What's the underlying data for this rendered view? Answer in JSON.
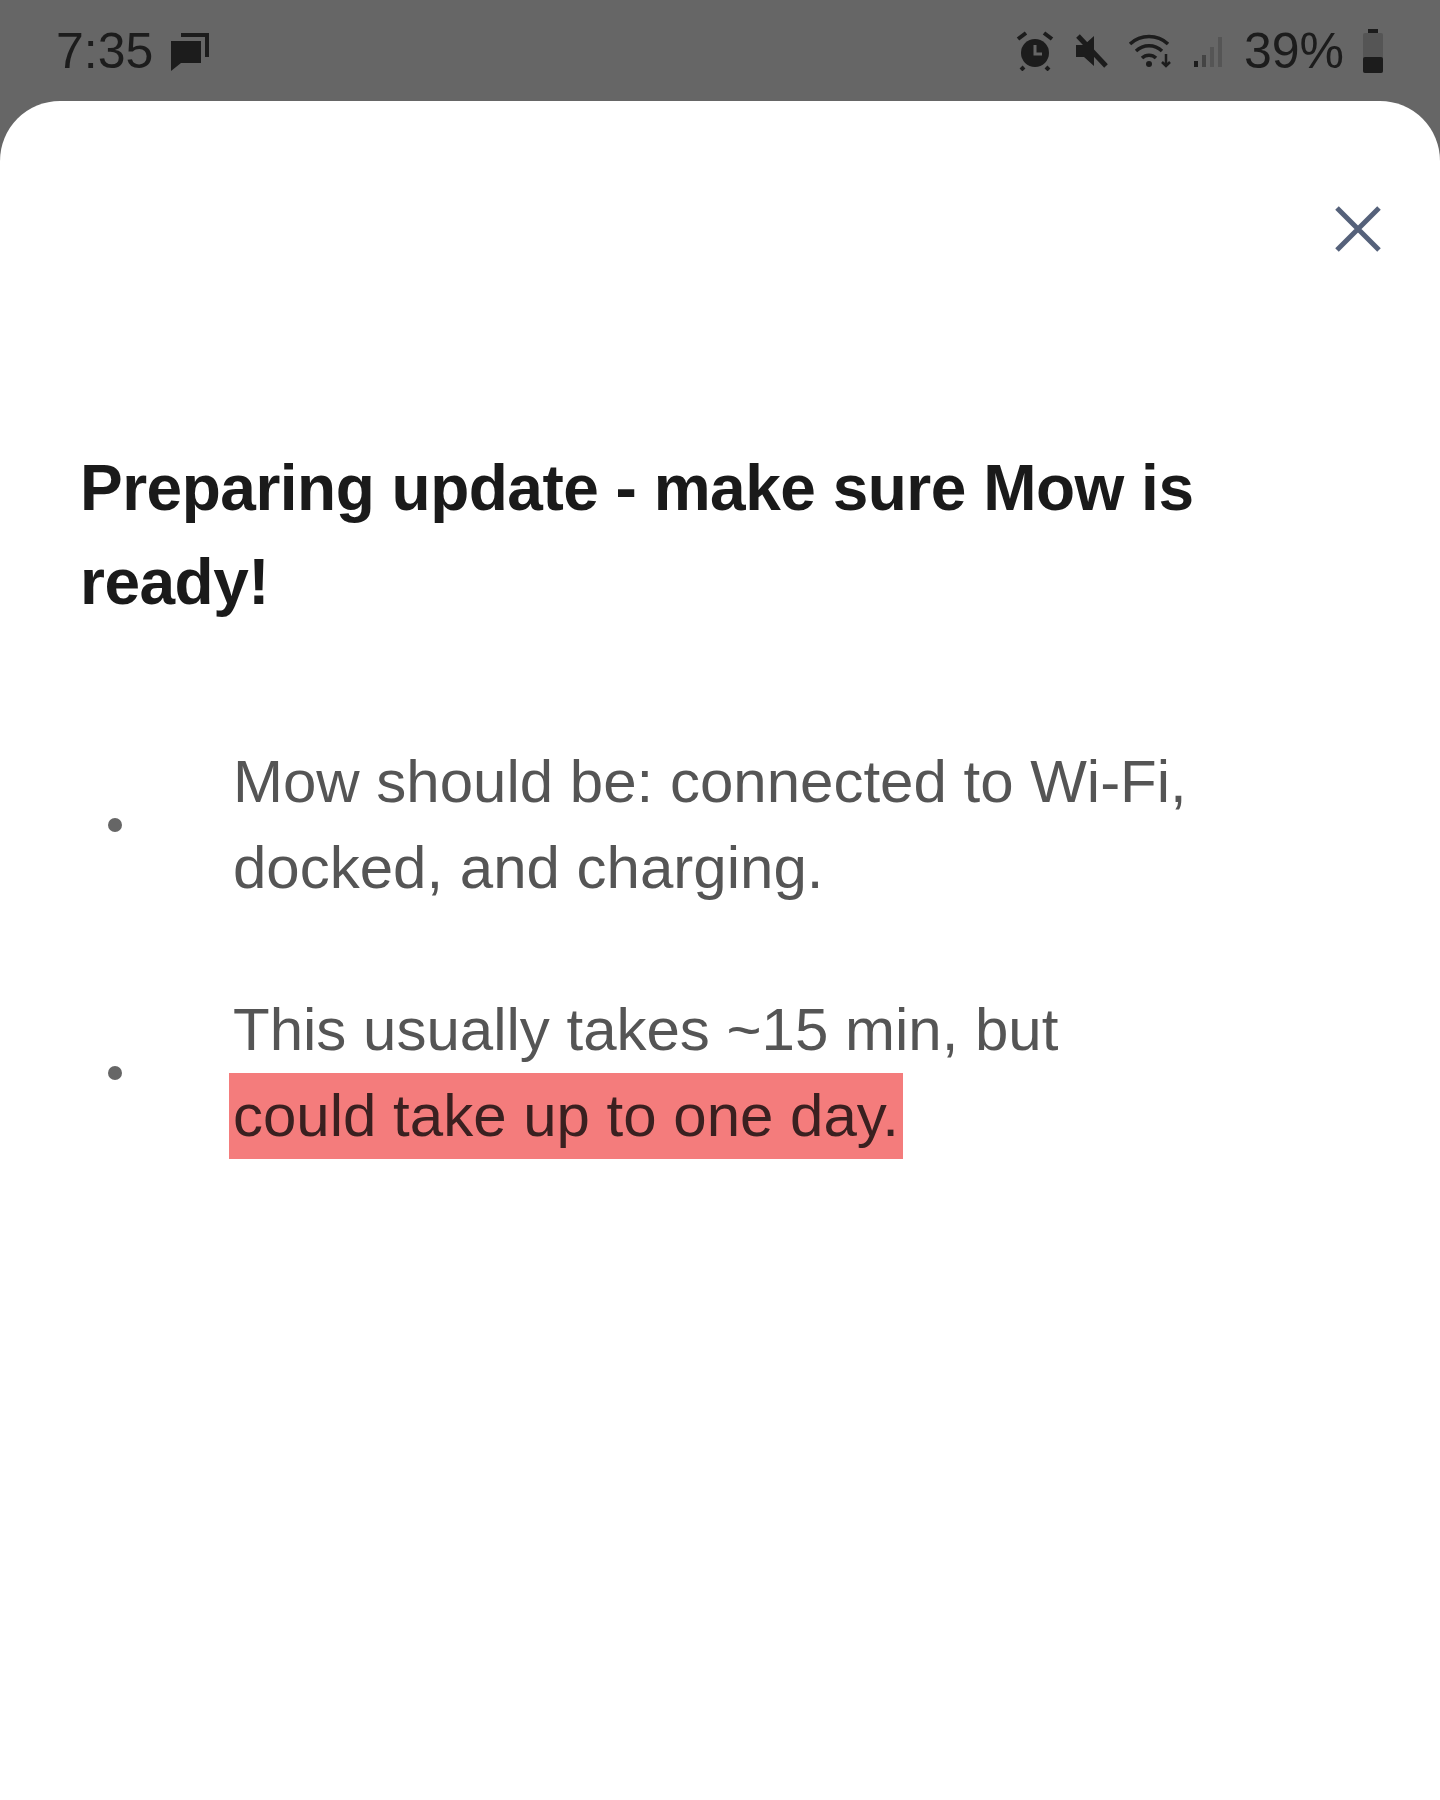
{
  "status_bar": {
    "time": "7:35",
    "battery": "39%"
  },
  "sheet": {
    "title": "Preparing update - make sure Mow is ready!",
    "bullets": [
      {
        "text": "Mow should be: connected to Wi-Fi, docked, and charging."
      },
      {
        "text": "This usually takes ~15 min, but",
        "highlight": "could take up to one day."
      }
    ]
  }
}
